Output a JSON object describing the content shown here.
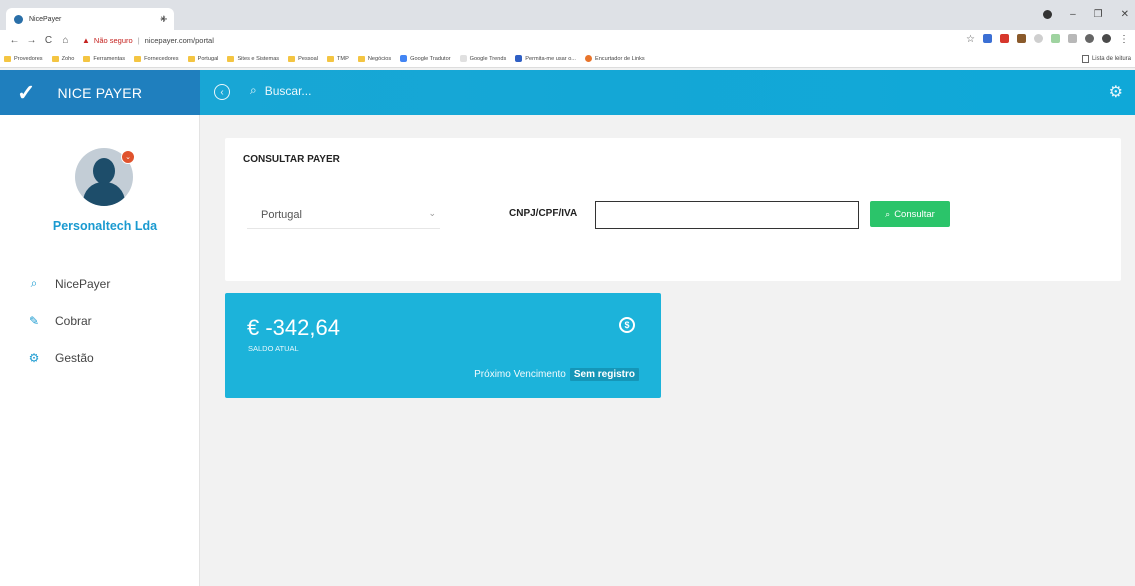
{
  "browser": {
    "tab_title": "NicePayer",
    "tab_close": "×",
    "new_tab": "+",
    "url_warning": "Não seguro",
    "url": "nicepayer.com/portal",
    "bookmarks": [
      "Provedores",
      "Zoho",
      "Ferramentas",
      "Fornecedores",
      "Portugal",
      "Sites e Sistemas",
      "Pessoal",
      "TMP",
      "Negócios",
      "Google Tradutor",
      "Google Trends",
      "Permita-me usar o...",
      "Encurtador de Links"
    ],
    "reading_list": "Lista de leitura"
  },
  "header": {
    "brand": "NICE PAYER",
    "search_placeholder": "Buscar..."
  },
  "sidebar": {
    "company": "Personaltech Lda",
    "items": [
      {
        "label": "NicePayer",
        "icon": "search-icon"
      },
      {
        "label": "Cobrar",
        "icon": "edit-icon"
      },
      {
        "label": "Gestão",
        "icon": "gear-icon"
      }
    ]
  },
  "consult": {
    "title": "CONSULTAR PAYER",
    "country": "Portugal",
    "id_label": "CNPJ/CPF/IVA",
    "id_value": "",
    "button": "Consultar"
  },
  "balance": {
    "amount": "€ -342,64",
    "label": "SALDO ATUAL",
    "next_due_label": "Próximo Vencimento",
    "next_due_value": "Sem registro"
  },
  "colors": {
    "accent": "#1aa6d4",
    "brand_bg": "#1f7fbe",
    "success": "#2bc46a",
    "tile": "#1cb3da",
    "badge": "#e0532d"
  }
}
